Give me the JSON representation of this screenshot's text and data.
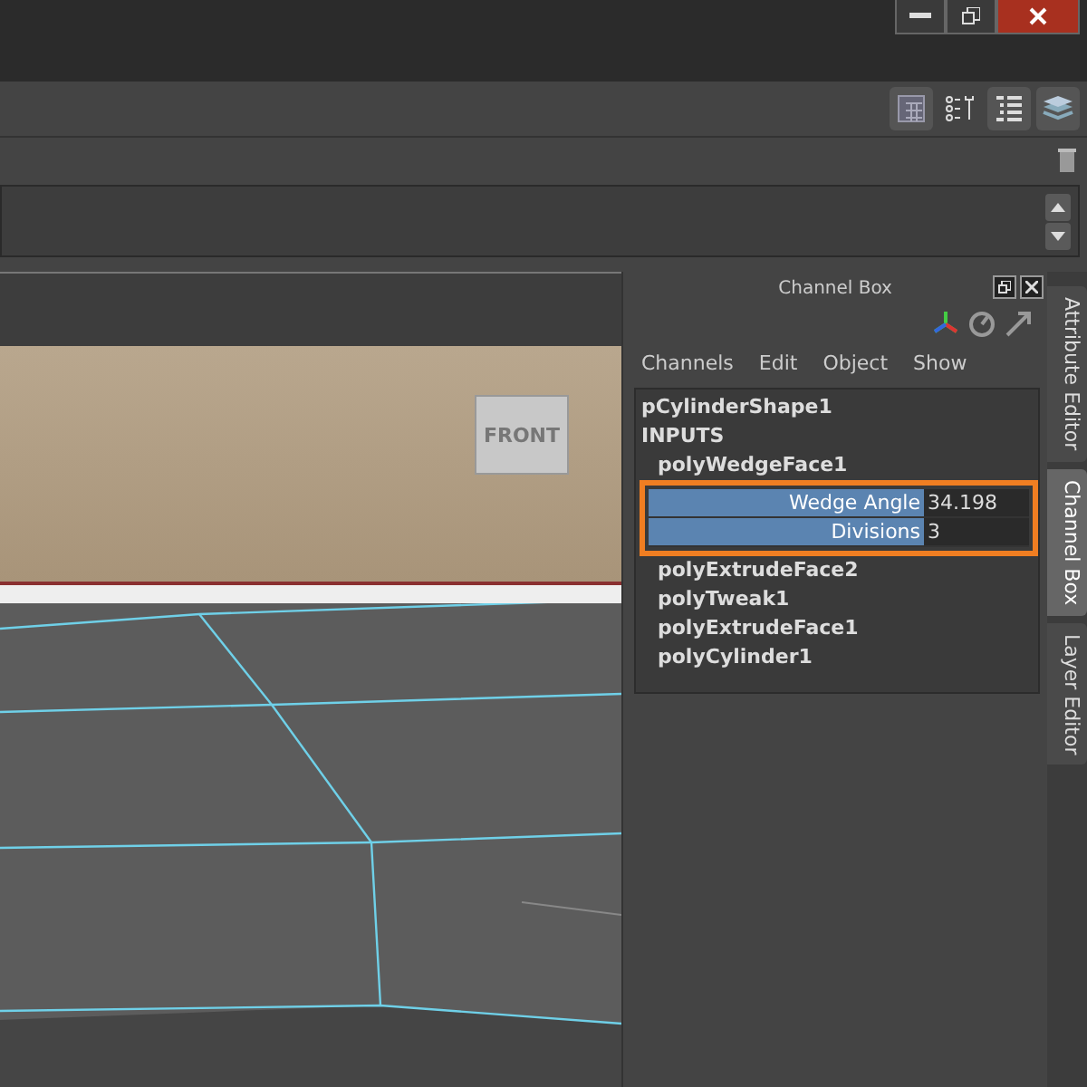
{
  "viewport": {
    "view_cube_label": "FRONT"
  },
  "channel_box": {
    "title": "Channel Box",
    "menu": [
      "Channels",
      "Edit",
      "Object",
      "Show"
    ],
    "shape": "pCylinderShape1",
    "inputs_label": "INPUTS",
    "nodes": [
      {
        "name": "polyWedgeFace1",
        "highlighted": true,
        "attributes": [
          {
            "name": "Wedge Angle",
            "value": "34.198"
          },
          {
            "name": "Divisions",
            "value": "3"
          }
        ]
      },
      {
        "name": "polyExtrudeFace2"
      },
      {
        "name": "polyTweak1"
      },
      {
        "name": "polyExtrudeFace1"
      },
      {
        "name": "polyCylinder1"
      }
    ]
  },
  "side_tabs": [
    {
      "label": "Attribute Editor",
      "selected": false
    },
    {
      "label": "Channel Box",
      "selected": true
    },
    {
      "label": "Layer Editor",
      "selected": false
    }
  ]
}
